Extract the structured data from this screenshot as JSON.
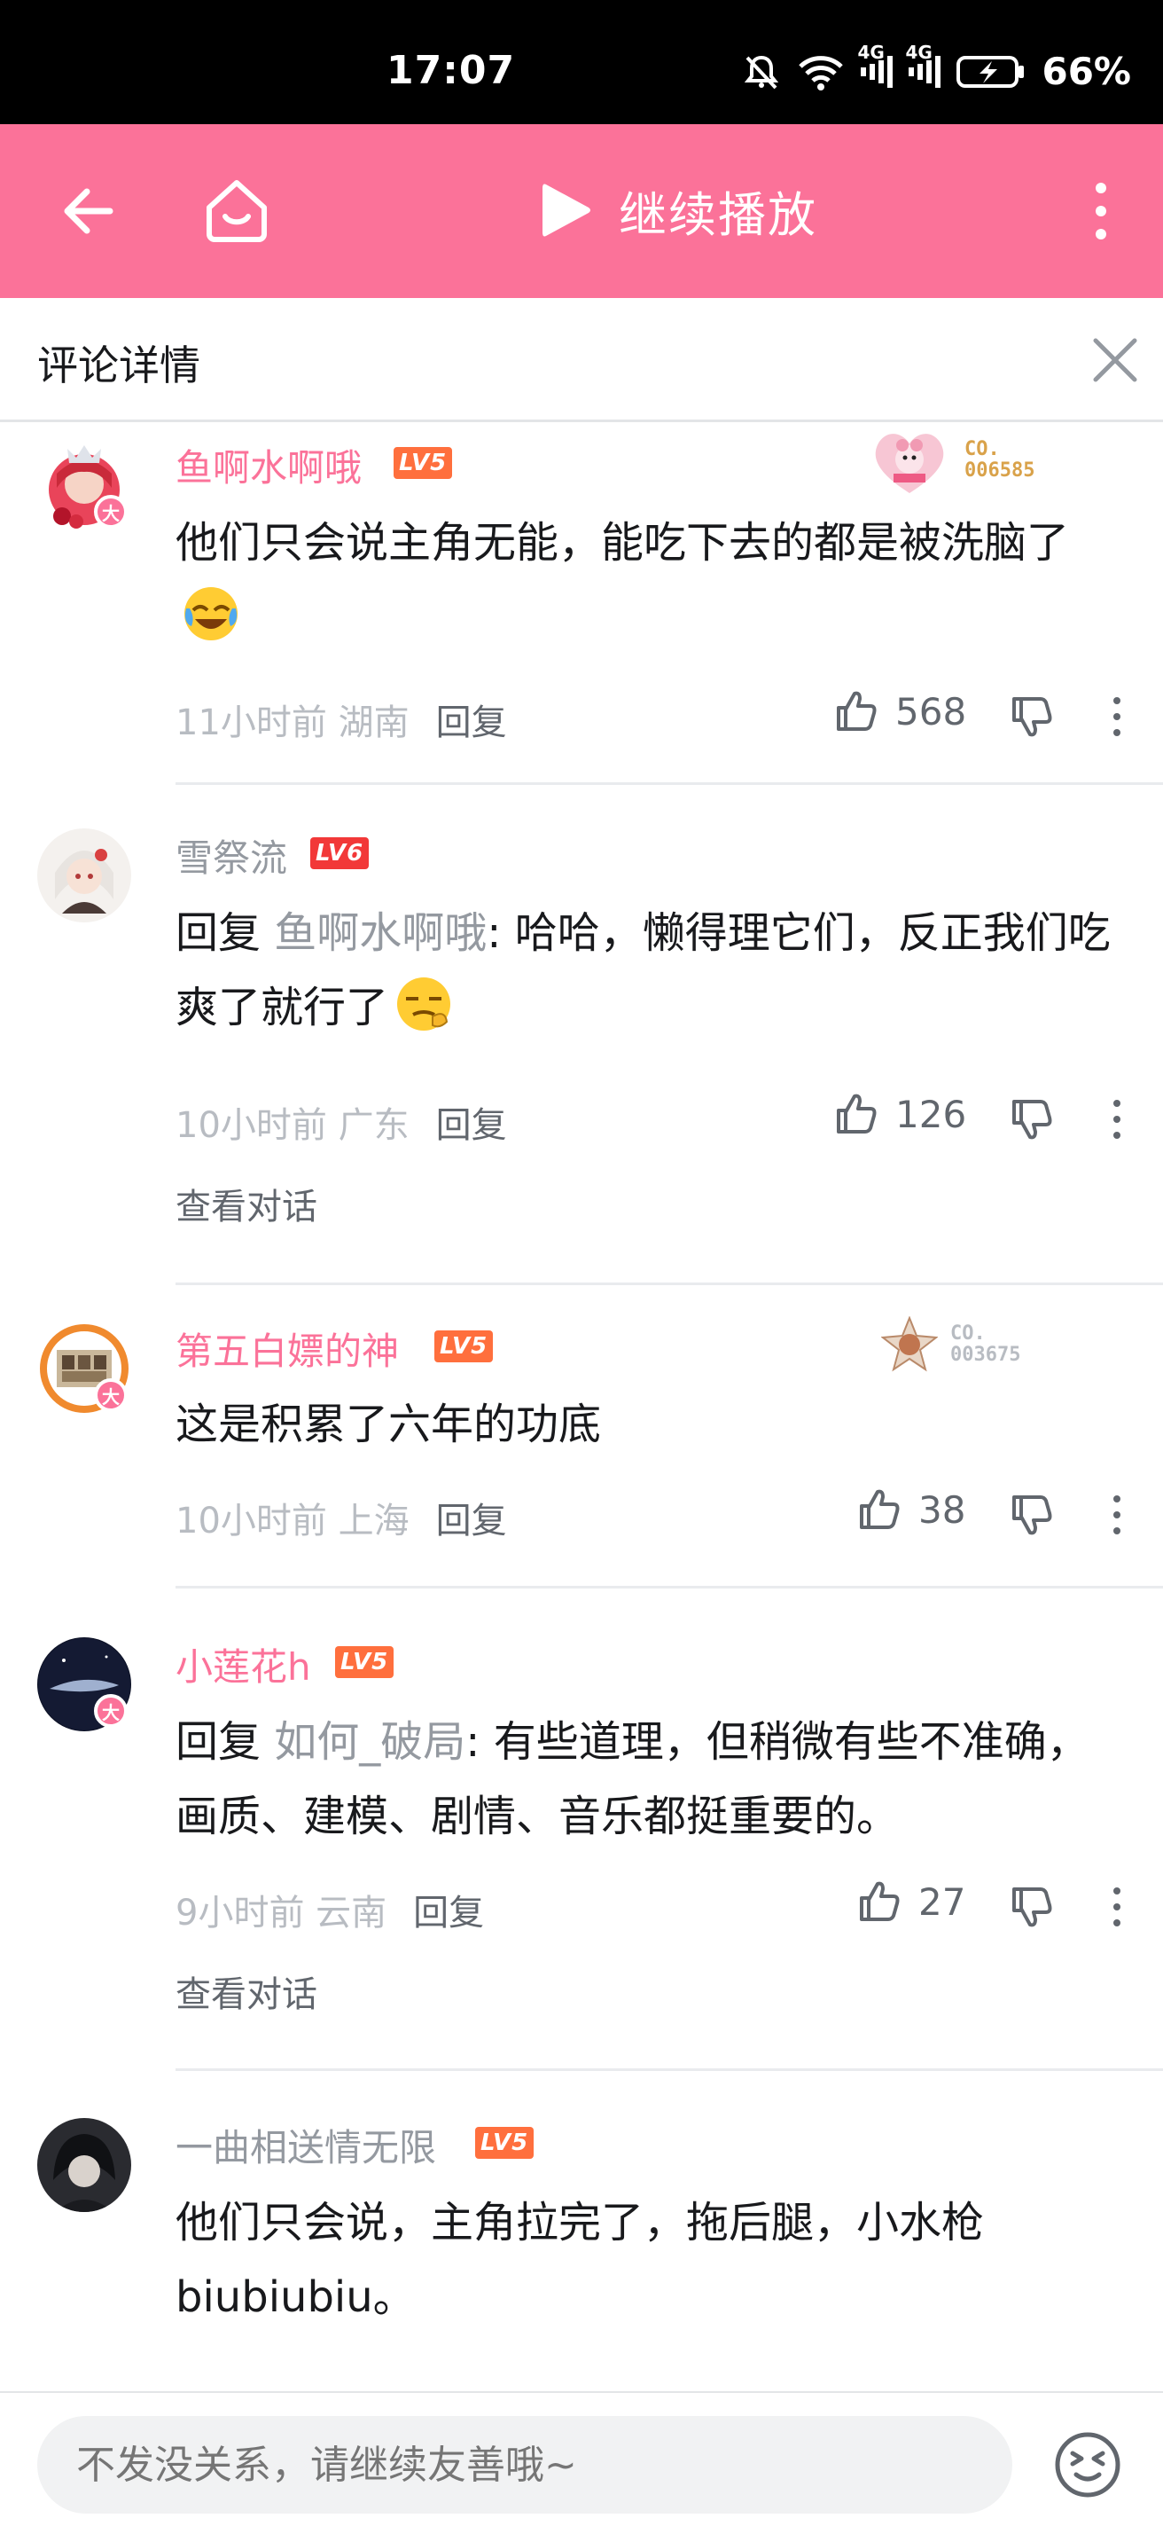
{
  "status": {
    "time": "17:07",
    "network1": "4G",
    "network2": "4G",
    "battery": "66%"
  },
  "topbar": {
    "continue_label": "继续播放"
  },
  "detail": {
    "title": "评论详情"
  },
  "comments": [
    {
      "username": "鱼啊水啊哦",
      "level": "LV5",
      "fan_badge": {
        "line1": "CO.",
        "line2": "006585"
      },
      "text": "他们只会说主角无能，能吃下去的都是被洗脑了",
      "emoji": "laughing-tears-emoji",
      "time": "11小时前",
      "location": "湖南",
      "reply": "回复",
      "likes": "568"
    },
    {
      "username": "雪祭流",
      "level": "LV6",
      "reply_prefix": "回复",
      "reply_to": "鱼啊水啊哦",
      "text": ": 哈哈，懒得理它们，反正我们吃爽了就行了",
      "emoji": "smug-emoji",
      "time": "10小时前",
      "location": "广东",
      "reply": "回复",
      "likes": "126",
      "view_conversation": "查看对话"
    },
    {
      "username": "第五白嫖的神",
      "level": "LV5",
      "fan_badge": {
        "line1": "CO.",
        "line2": "003675"
      },
      "text": "这是积累了六年的功底",
      "time": "10小时前",
      "location": "上海",
      "reply": "回复",
      "likes": "38"
    },
    {
      "username": "小莲花h",
      "level": "LV5",
      "reply_prefix": "回复",
      "reply_to": "如何_破局",
      "text": ": 有些道理，但稍微有些不准确，画质、建模、剧情、音乐都挺重要的。",
      "time": "9小时前",
      "location": "云南",
      "reply": "回复",
      "likes": "27",
      "view_conversation": "查看对话"
    },
    {
      "username": "一曲相送情无限",
      "level": "LV5",
      "text": "他们只会说，主角拉完了，拖后腿，小水枪biubiubiu。"
    }
  ],
  "avatar_badge": "大",
  "input": {
    "placeholder": "不发没关系，请继续友善哦~"
  },
  "colors": {
    "brand_pink": "#fb7299",
    "level_orange": "#ff6f3d",
    "level_red": "#f23838",
    "text_grey": "#9499a0"
  }
}
